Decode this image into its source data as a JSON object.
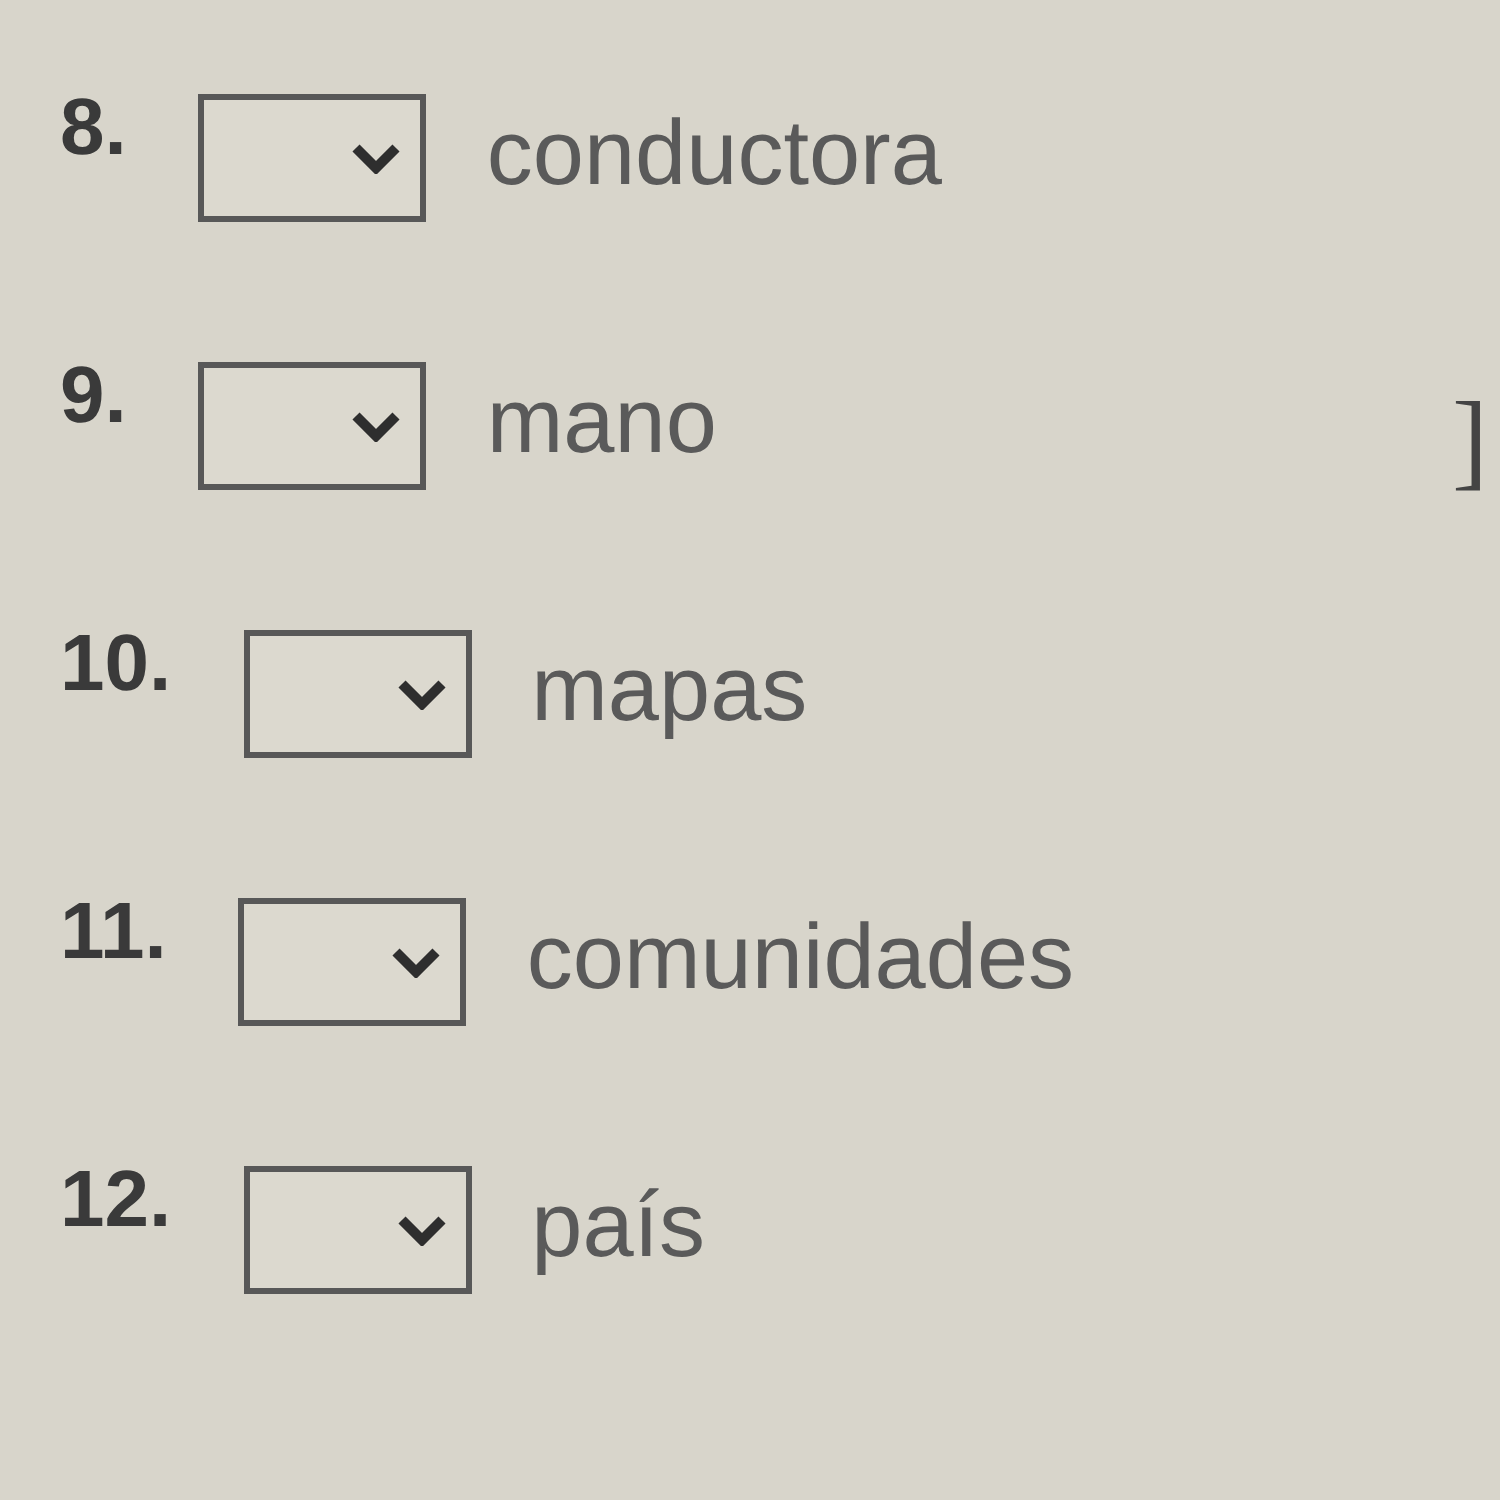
{
  "items": [
    {
      "number": "8.",
      "word": "conductora"
    },
    {
      "number": "9.",
      "word": "mano",
      "trailing": "]"
    },
    {
      "number": "10.",
      "word": "mapas"
    },
    {
      "number": "11.",
      "word": "comunidades"
    },
    {
      "number": "12.",
      "word": "país"
    }
  ]
}
